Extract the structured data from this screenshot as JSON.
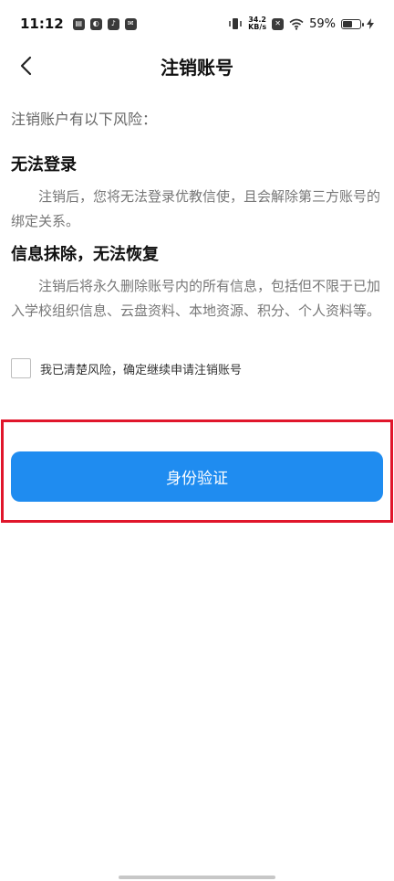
{
  "status_bar": {
    "time": "11:12",
    "net_speed_value": "34.2",
    "net_speed_unit": "KB/s",
    "battery_percent": "59%",
    "battery_level": 0.59
  },
  "header": {
    "title": "注销账号"
  },
  "content": {
    "intro": "注销账户有以下风险：",
    "risks": [
      {
        "title": "无法登录",
        "description": "注销后，您将无法登录优教信使，且会解除第三方账号的绑定关系。"
      },
      {
        "title": "信息抹除，无法恢复",
        "description": "注销后将永久删除账号内的所有信息，包括但不限于已加入学校组织信息、云盘资料、本地资源、积分、个人资料等。"
      }
    ],
    "agree_label": "我已清楚风险，确定继续申请注销账号"
  },
  "actions": {
    "verify_label": "身份验证"
  },
  "colors": {
    "primary": "#1f8cf0",
    "highlight_frame": "#e0162b"
  }
}
